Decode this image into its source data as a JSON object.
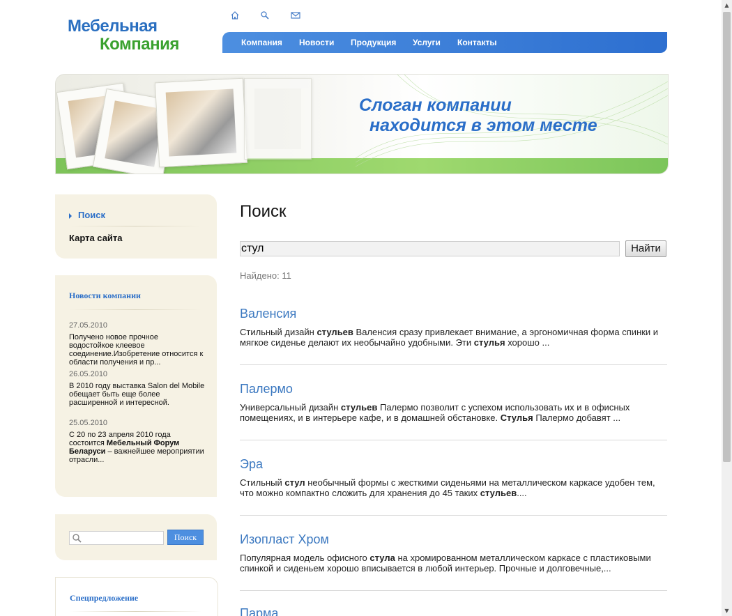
{
  "header": {
    "logo_line1": "Мебельная",
    "logo_line2": "Компания",
    "icons": [
      "home-icon",
      "search-icon",
      "mail-icon"
    ]
  },
  "nav": [
    "Компания",
    "Новости",
    "Продукция",
    "Услуги",
    "Контакты"
  ],
  "banner": {
    "slogan_line1": "Слоган компании",
    "slogan_line2": "находится в этом месте"
  },
  "sidebar": {
    "menu": [
      "Поиск",
      "Карта сайта"
    ],
    "news_title": "Новости компании",
    "news": [
      {
        "date": "27.05.2010",
        "text": "Получено новое прочное водостойкое клеевое соединение.Изобретение относится к области получения и пр..."
      },
      {
        "date": "26.05.2010",
        "text": "В 2010 году выставка Salon del Mobile обещает быть еще более расширенной и интересной."
      },
      {
        "date": "25.05.2010",
        "text_pre": "С 20 по 23 апреля 2010 года состоится ",
        "text_bold": "Мебельный Форум Беларуси",
        "text_post": " – важнейшее мероприятии отрасли..."
      }
    ],
    "search_button": "Поиск",
    "special_title": "Спецпредложение"
  },
  "main": {
    "title": "Поиск",
    "query": "стул",
    "search_button": "Найти",
    "found": "Найдено: 11",
    "results": [
      {
        "title": "Валенсия",
        "parts": [
          [
            "Стильный дизайн ",
            false
          ],
          [
            "стульев",
            true
          ],
          [
            " Валенсия сразу привлекает внимание, а эргономичная форма спинки и мягкое сиденье делают их необычайно удобными. Эти ",
            false
          ],
          [
            "стулья",
            true
          ],
          [
            " хорошо ...",
            false
          ]
        ]
      },
      {
        "title": "Палермо",
        "parts": [
          [
            "Универсальный дизайн ",
            false
          ],
          [
            "стульев",
            true
          ],
          [
            " Палермо позволит с успехом использовать их и в офисных помещениях, и в интерьере кафе, и в домашней обстановке. ",
            false
          ],
          [
            "Стулья",
            true
          ],
          [
            " Палермо добавят ...",
            false
          ]
        ]
      },
      {
        "title": "Эра",
        "parts": [
          [
            "Стильный ",
            false
          ],
          [
            "стул",
            true
          ],
          [
            " необычный формы с жесткими сиденьями на металлическом каркасе удобен тем, что можно компактно сложить для хранения до 45 таких ",
            false
          ],
          [
            "стульев",
            true
          ],
          [
            "....",
            false
          ]
        ]
      },
      {
        "title": "Изопласт Хром",
        "parts": [
          [
            "Популярная модель офисного ",
            false
          ],
          [
            "стула",
            true
          ],
          [
            " на хромированном металлическом каркасе с пластиковыми спинкой и сиденьем хорошо вписывается в любой интерьер. Прочные и долговечные,...",
            false
          ]
        ]
      },
      {
        "title": "Парма",
        "parts": []
      }
    ]
  }
}
